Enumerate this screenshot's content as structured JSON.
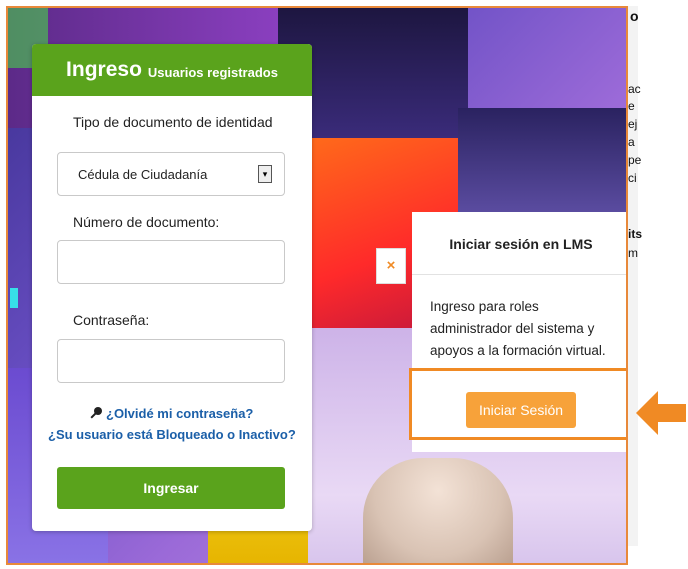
{
  "login": {
    "title": "Ingreso",
    "subtitle": "Usuarios registrados",
    "doc_type_label": "Tipo de documento de identidad",
    "doc_type_value": "Cédula de Ciudadanía",
    "doc_number_label": "Número de documento:",
    "password_label": "Contraseña:",
    "forgot_password": "¿Olvidé mi contraseña?",
    "blocked_user": "¿Su usuario está Bloqueado o Inactivo?",
    "submit_label": "Ingresar"
  },
  "lms": {
    "title": "Iniciar sesión en LMS",
    "description": "Ingreso para roles administrador del sistema y apoyos a la formación virtual.",
    "button_label": "Iniciar Sesión",
    "close_glyph": "×"
  },
  "page_edge_text": [
    "o",
    "ac",
    "e",
    "ej",
    "a",
    "pe",
    "ci",
    "its",
    "m"
  ],
  "colors": {
    "accent_green": "#5aa31c",
    "accent_orange": "#f08a24",
    "link_blue": "#1b5fa8"
  },
  "icons": {
    "close": "close-icon",
    "key": "key-icon",
    "dropdown": "chevron-down-icon",
    "pointer": "arrow-left-icon"
  }
}
